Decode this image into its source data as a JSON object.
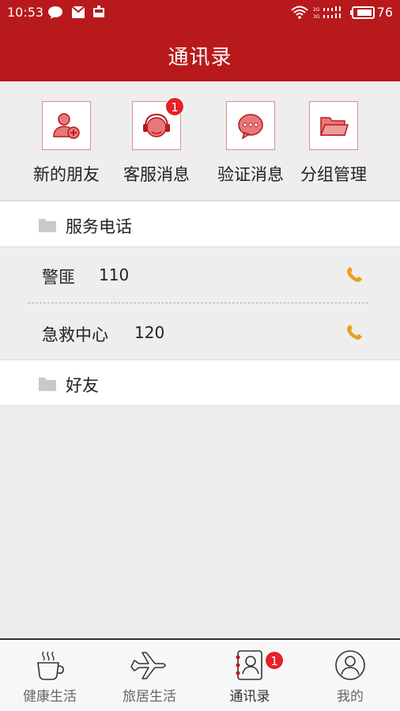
{
  "status_bar": {
    "time": "10:53",
    "battery": "76",
    "icons": [
      "chat-icon",
      "mail-icon",
      "train-icon",
      "wifi-icon",
      "signal-icon",
      "battery-icon"
    ]
  },
  "header": {
    "title": "通讯录"
  },
  "quick_actions": [
    {
      "label": "新的朋友",
      "icon": "add-user-icon"
    },
    {
      "label": "客服消息",
      "icon": "headset-icon",
      "badge": "1"
    },
    {
      "label": "验证消息",
      "icon": "message-icon"
    },
    {
      "label": "分组管理",
      "icon": "folder-icon"
    }
  ],
  "groups": [
    {
      "title": "服务电话",
      "icon": "folder-icon",
      "contacts": [
        {
          "name": "警匪",
          "number": "110"
        },
        {
          "name": "急救中心",
          "number": "120"
        }
      ]
    },
    {
      "title": "好友",
      "icon": "folder-icon",
      "contacts": []
    }
  ],
  "tabs": [
    {
      "label": "健康生活",
      "icon": "coffee-cup-icon"
    },
    {
      "label": "旅居生活",
      "icon": "airplane-icon"
    },
    {
      "label": "通讯录",
      "icon": "contacts-book-icon",
      "badge": "1",
      "active": true
    },
    {
      "label": "我的",
      "icon": "user-circle-icon"
    }
  ],
  "colors": {
    "primary": "#b8191c",
    "badge": "#e62129",
    "phone": "#e8a020",
    "background": "#eeeeee"
  }
}
